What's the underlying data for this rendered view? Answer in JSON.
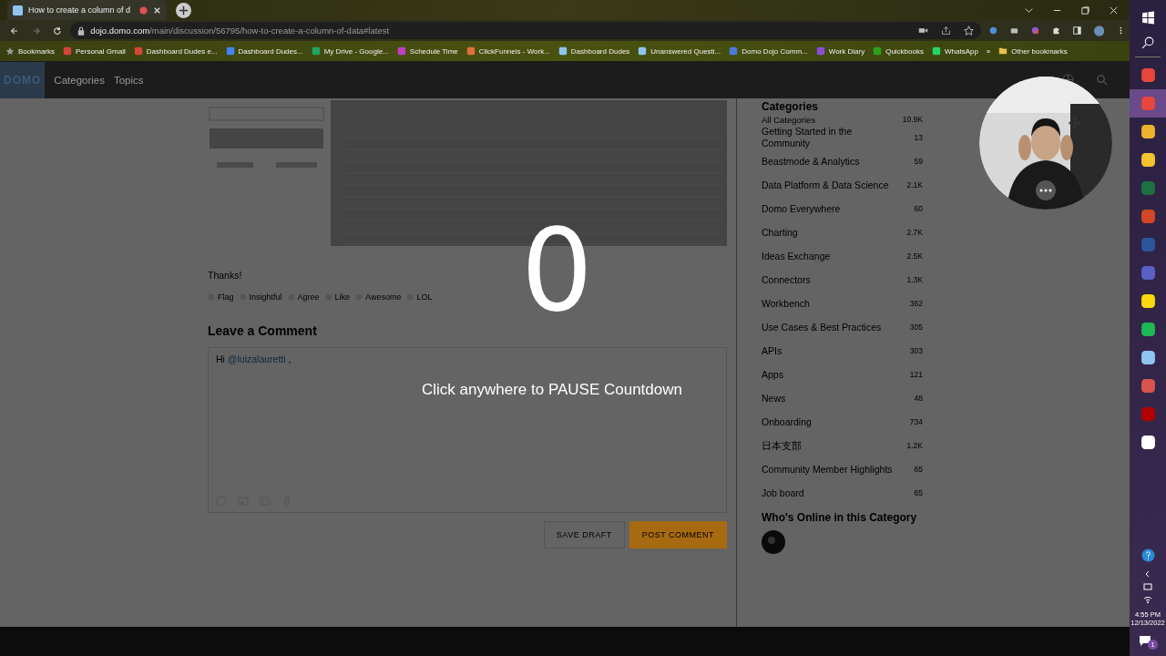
{
  "browser": {
    "tab_title": "How to create a column of d",
    "url_host": "dojo.domo.com",
    "url_path": "/main/discussion/56795/how-to-create-a-column-of-data#latest",
    "bookmarks": [
      {
        "label": "Bookmarks",
        "kind": "star",
        "color": "#9a9a9a"
      },
      {
        "label": "Personal Gmail",
        "kind": "site",
        "color": "#d44638"
      },
      {
        "label": "Dashboard Dudes e...",
        "kind": "site",
        "color": "#d44638"
      },
      {
        "label": "Dashboard Dudes...",
        "kind": "site",
        "color": "#4285f4"
      },
      {
        "label": "My Drive - Google...",
        "kind": "site",
        "color": "#1fa463"
      },
      {
        "label": "Schedule Time",
        "kind": "site",
        "color": "#c23fc2"
      },
      {
        "label": "ClickFunnels - Work...",
        "kind": "site",
        "color": "#e0703a"
      },
      {
        "label": "Dashboard Dudes",
        "kind": "site",
        "color": "#8ec5f0"
      },
      {
        "label": "Unanswered Questi...",
        "kind": "site",
        "color": "#8ec5f0"
      },
      {
        "label": "Domo Dojo Comm...",
        "kind": "site",
        "color": "#4a7bd8"
      },
      {
        "label": "Work Diary",
        "kind": "site",
        "color": "#8a4fd8"
      },
      {
        "label": "Quickbooks",
        "kind": "site",
        "color": "#2ca01c"
      },
      {
        "label": "WhatsApp",
        "kind": "site",
        "color": "#25d366"
      }
    ],
    "overflow": "»",
    "other_bookmarks": "Other bookmarks"
  },
  "site_nav": {
    "logo": "DOMO",
    "items": [
      "Categories",
      "Topics"
    ]
  },
  "post": {
    "text": "Thanks!",
    "reactions": [
      "Flag",
      "Insightful",
      "Agree",
      "Like",
      "Awesome",
      "LOL"
    ]
  },
  "comment": {
    "heading": "Leave a Comment",
    "greeting": "Hi",
    "mention": "@luizalauretti",
    "trail": ",",
    "buttons": [
      {
        "label": "SAVE DRAFT",
        "kind": "secondary"
      },
      {
        "label": "POST COMMENT",
        "kind": "primary"
      }
    ]
  },
  "sidebar": {
    "heading": "Categories",
    "items": [
      {
        "name": "All Categories",
        "count": "10.9K",
        "kind": "all"
      },
      {
        "name": "Getting Started in the Community",
        "count": "13",
        "kind": "category"
      },
      {
        "name": "Beastmode & Analytics",
        "count": "59",
        "kind": "category"
      },
      {
        "name": "Data Platform & Data Science",
        "count": "2.1K",
        "kind": "category"
      },
      {
        "name": "Domo Everywhere",
        "count": "60",
        "kind": "category"
      },
      {
        "name": "Charting",
        "count": "2.7K",
        "kind": "category"
      },
      {
        "name": "Ideas Exchange",
        "count": "2.5K",
        "kind": "category"
      },
      {
        "name": "Connectors",
        "count": "1.3K",
        "kind": "category"
      },
      {
        "name": "Workbench",
        "count": "362",
        "kind": "category"
      },
      {
        "name": "Use Cases & Best Practices",
        "count": "305",
        "kind": "category"
      },
      {
        "name": "APIs",
        "count": "303",
        "kind": "category"
      },
      {
        "name": "Apps",
        "count": "121",
        "kind": "category"
      },
      {
        "name": "News",
        "count": "48",
        "kind": "category"
      },
      {
        "name": "Onboarding",
        "count": "734",
        "kind": "category"
      },
      {
        "name": "日本支部",
        "count": "1.2K",
        "kind": "category"
      },
      {
        "name": "Community Member Highlights",
        "count": "65",
        "kind": "category"
      },
      {
        "name": "Job board",
        "count": "65",
        "kind": "category"
      }
    ],
    "online_heading": "Who's Online in this Category"
  },
  "countdown": {
    "number": "0",
    "hint": "Click anywhere to PAUSE Countdown"
  },
  "taskbar": {
    "apps": [
      {
        "color": "#e8453c",
        "selected": false
      },
      {
        "color": "#e8453c",
        "selected": true
      },
      {
        "color": "#ecb22e",
        "selected": false
      },
      {
        "color": "#f4c430",
        "selected": false
      },
      {
        "color": "#1d7044",
        "selected": false
      },
      {
        "color": "#d24726",
        "selected": false
      },
      {
        "color": "#2b579a",
        "selected": false
      },
      {
        "color": "#5b5fc7",
        "selected": false
      },
      {
        "color": "#f7d90d",
        "selected": false
      },
      {
        "color": "#1db954",
        "selected": false
      },
      {
        "color": "#8ec5f0",
        "selected": false
      },
      {
        "color": "#d9534f",
        "selected": false
      },
      {
        "color": "#b30000",
        "selected": false
      },
      {
        "color": "#ffffff",
        "selected": false
      }
    ],
    "time": "4:55 PM",
    "date": "12/13/2022",
    "notifications": "1"
  }
}
